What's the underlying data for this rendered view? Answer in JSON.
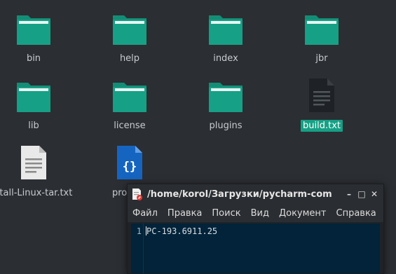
{
  "files": [
    {
      "name": "bin",
      "type": "folder"
    },
    {
      "name": "help",
      "type": "folder"
    },
    {
      "name": "index",
      "type": "folder"
    },
    {
      "name": "jbr",
      "type": "folder"
    },
    {
      "name": "lib",
      "type": "folder"
    },
    {
      "name": "license",
      "type": "folder"
    },
    {
      "name": "plugins",
      "type": "folder"
    },
    {
      "name": "build.txt",
      "type": "text-file",
      "selected": true
    },
    {
      "name": "stall-Linux-tar.txt",
      "type": "text-file"
    },
    {
      "name": "product",
      "type": "json-file"
    }
  ],
  "colors": {
    "folder": "#16a085",
    "folder_tab": "#1abc9c",
    "selection": "#16a085",
    "editor_bg": "#022339"
  },
  "editor": {
    "title": "/home/korol/Загрузки/pycharm-com",
    "minimize": "–",
    "maximize": "□",
    "close": "✕",
    "menu": [
      "Файл",
      "Правка",
      "Поиск",
      "Вид",
      "Документ",
      "Справка"
    ],
    "line_number": "1",
    "content": "PC-193.6911.25"
  }
}
